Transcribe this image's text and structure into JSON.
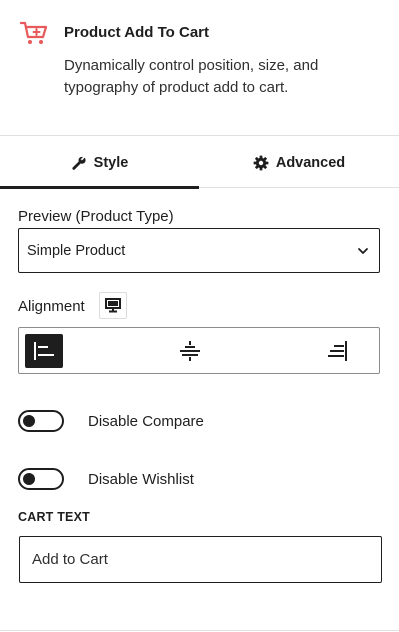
{
  "block": {
    "title": "Product Add To Cart",
    "description": "Dynamically control position, size, and typography of product add to cart.",
    "icon": "cart-plus-icon",
    "icon_color": "#e8595b"
  },
  "tabs": [
    {
      "label": "Style",
      "icon": "wrench-icon",
      "active": true
    },
    {
      "label": "Advanced",
      "icon": "gear-icon",
      "active": false
    }
  ],
  "preview": {
    "label": "Preview (Product Type)",
    "selected": "Simple Product"
  },
  "alignment": {
    "label": "Alignment",
    "device_icon": "desktop-icon",
    "options": [
      "left",
      "center",
      "right"
    ],
    "selected": "left"
  },
  "toggles": [
    {
      "label": "Disable Compare",
      "on": false
    },
    {
      "label": "Disable Wishlist",
      "on": false
    }
  ],
  "cart_text": {
    "label": "CART TEXT",
    "value": "Add to Cart"
  }
}
